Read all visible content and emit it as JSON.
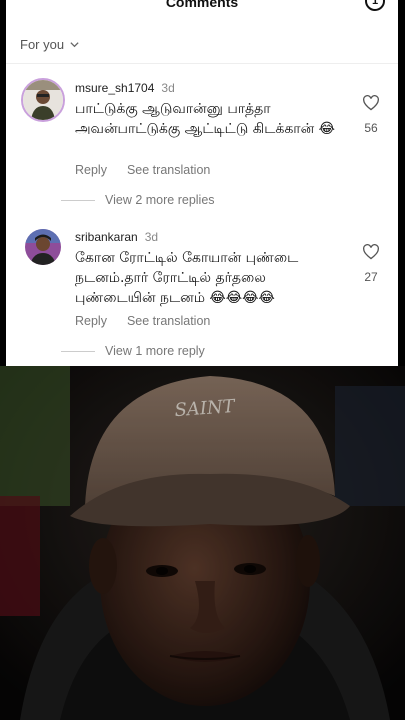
{
  "header": {
    "title": "Comments",
    "badge": "1"
  },
  "filter": {
    "label": "For you"
  },
  "comments": [
    {
      "username": "msure_sh1704",
      "time": "3d",
      "text": "பாட்டுக்கு ஆடுவான்னு பாத்தா அவன்பாட்டுக்கு ஆட்டிட்டு கிடக்கான் 😂",
      "likes": "56",
      "reply_label": "Reply",
      "translate_label": "See translation",
      "more_replies": "View 2 more replies"
    },
    {
      "username": "sribankaran",
      "time": "3d",
      "text": "கோன ரோட்டில் கோயான் புண்டை நடனம்.தார் ரோட்டில் தர்தலை புண்டையின் நடனம் 😂😂😂😂",
      "likes": "27",
      "reply_label": "Reply",
      "translate_label": "See translation",
      "more_replies": "View 1 more reply"
    }
  ],
  "photo": {
    "cap_text": "SAINT"
  }
}
